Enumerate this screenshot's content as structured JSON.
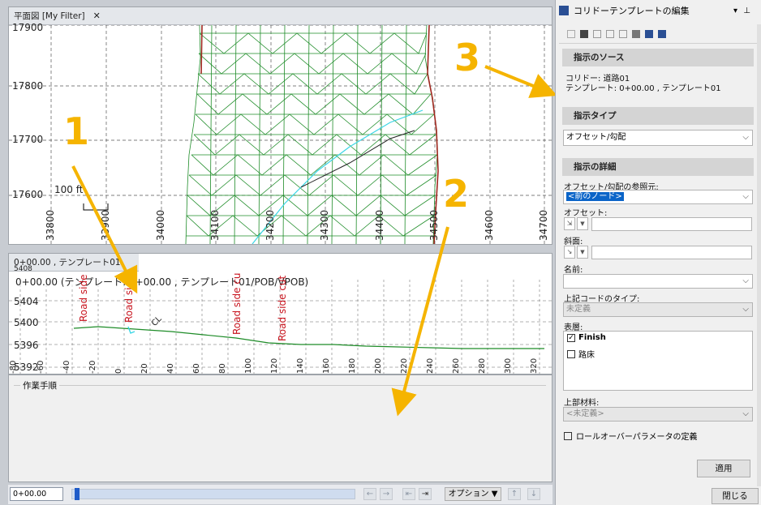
{
  "plan_view": {
    "tab_title": "平面図 [My Filter]",
    "close": "✕",
    "northings": [
      "17900",
      "17800",
      "17700",
      "17600"
    ],
    "eastings": [
      "33800",
      "33900",
      "34000",
      "34100",
      "34200",
      "34300",
      "34400",
      "34500",
      "34600",
      "34700"
    ],
    "scale_label": "100 ft"
  },
  "cross_section": {
    "tab_title": "0+00.00 , テンプレート01",
    "header": "0+00.00 (テンプレート: 0+00.00 , テンプレート01/POB/VPOB)",
    "elevations": [
      "5408",
      "5404",
      "5400",
      "5396",
      "5392"
    ],
    "offsets": [
      "-80",
      "-60",
      "-40",
      "-20",
      "0",
      "20",
      "40",
      "60",
      "80",
      "100",
      "120",
      "140",
      "160",
      "180",
      "200",
      "220",
      "240",
      "260",
      "280",
      "300",
      "320"
    ],
    "road_labels": [
      "Road side",
      "Road side",
      "Road side cu",
      "Road side cut"
    ],
    "cl_label": "CL"
  },
  "workflow": {
    "title": "作業手順"
  },
  "bottom": {
    "station": "0+00.00",
    "options": "オプション ▼"
  },
  "panel": {
    "title": "コリドーテンプレートの編集",
    "pin": "▾",
    "pin2": "⊥",
    "source_header": "指示のソース",
    "corridor": "コリドー: 道路01",
    "template": "テンプレート: 0+00.00 , テンプレート01",
    "type_header": "指示タイプ",
    "type_value": "オフセット/勾配",
    "detail_header": "指示の詳細",
    "ref_label": "オフセット/勾配の参照元:",
    "ref_value": "<前のノード>",
    "offset_label": "オフセット:",
    "slope_label": "斜面:",
    "name_label": "名前:",
    "code_type_label": "上記コードのタイプ:",
    "code_type_value": "未定義",
    "surface_label": "表層:",
    "surfaces": [
      {
        "name": "Finish",
        "checked": true
      },
      {
        "name": "路床",
        "checked": false
      }
    ],
    "material_label": "上部材料:",
    "material_value": "<未定義>",
    "rollover_label": "ロールオーバーパラメータの定義",
    "apply": "適用",
    "close": "閉じる"
  },
  "annotations": {
    "one": "1",
    "two": "2",
    "three": "3"
  },
  "colors": {
    "arrow": "#f5b400",
    "mesh": "#1e8c28",
    "cyan": "#3ad6e6",
    "boundary": "#a02820",
    "selected": "#0a64c8"
  }
}
